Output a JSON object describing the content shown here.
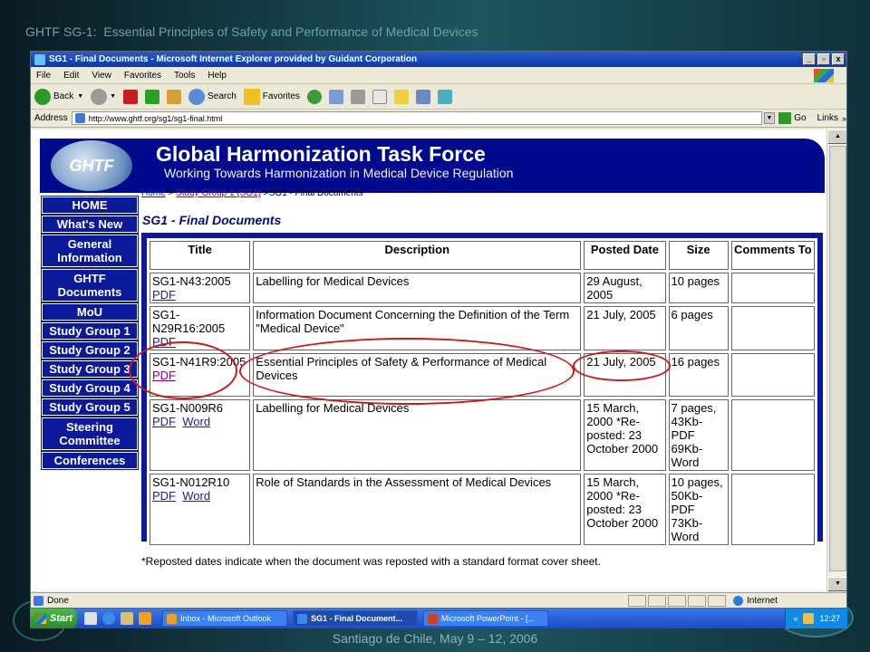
{
  "slide": {
    "title": "GHTF SG-1:  Essential Principles of Safety and Performance of Medical Devices",
    "footer": "Santiago de Chile, May 9 – 12, 2006"
  },
  "window": {
    "title": "SG1 - Final Documents - Microsoft Internet Explorer provided by Guidant Corporation",
    "minimize": "_",
    "maximize": "▫",
    "close": "x"
  },
  "menu": [
    "File",
    "Edit",
    "View",
    "Favorites",
    "Tools",
    "Help"
  ],
  "toolbar": {
    "back": "Back",
    "search": "Search",
    "favorites": "Favorites"
  },
  "address": {
    "label": "Address",
    "url": "http://www.ghtf.org/sg1/sg1-final.html",
    "go": "Go",
    "links": "Links"
  },
  "banner": {
    "logo": "GHTF",
    "title": "Global Harmonization Task Force",
    "subtitle": "Working Towards Harmonization in Medical Device Regulation"
  },
  "nav": [
    "HOME",
    "What's New",
    "General Information",
    "GHTF Documents",
    "MoU",
    "Study Group 1",
    "Study Group 2",
    "Study Group 3",
    "Study Group 4",
    "Study Group 5",
    "Steering Committee",
    "Conferences"
  ],
  "breadcrumb": {
    "home": "Home",
    "sep1": " > ",
    "group": "Study Group 1 (SG1)",
    "current": " >SG1 - Final Documents"
  },
  "page_title": "SG1 - Final Documents",
  "table": {
    "headers": [
      "Title",
      "Description",
      "Posted Date",
      "Size",
      "Comments To"
    ],
    "rows": [
      {
        "title": "SG1-N43:2005",
        "links": [
          "PDF"
        ],
        "description": "Labelling for Medical Devices",
        "date": "29 August, 2005",
        "size": "10 pages",
        "comments": ""
      },
      {
        "title": "SG1-N29R16:2005",
        "links": [
          "PDF"
        ],
        "description": "Information Document Concerning the Definition of the Term \"Medical Device\"",
        "date": "21 July, 2005",
        "size": "6 pages",
        "comments": ""
      },
      {
        "title": "SG1-N41R9:2005",
        "links": [
          "PDF"
        ],
        "description": "Essential Principles of Safety & Performance of Medical Devices",
        "date": "21 July, 2005",
        "size": "16 pages",
        "comments": ""
      },
      {
        "title": "SG1-N009R6",
        "links": [
          "PDF",
          "Word"
        ],
        "description": "Labelling for Medical Devices",
        "date": "15 March, 2000 *Re-posted: 23 October 2000",
        "size": "7 pages, 43Kb- PDF 69Kb- Word",
        "comments": ""
      },
      {
        "title": "SG1-N012R10",
        "links": [
          "PDF",
          "Word"
        ],
        "description": "Role of Standards in the Assessment of Medical Devices",
        "date": "15 March, 2000 *Re-posted: 23 October 2000",
        "size": "10 pages, 50Kb- PDF 73Kb- Word",
        "comments": ""
      }
    ]
  },
  "note": "*Reposted dates indicate when the document was reposted with a standard format cover sheet.",
  "status": {
    "text": "Done",
    "zone": "Internet"
  },
  "taskbar": {
    "start": "Start",
    "tasks": [
      "Inbox - Microsoft Outlook",
      "SG1 - Final Document...",
      "Microsoft PowerPoint - [..."
    ],
    "tray_arrow": "«",
    "clock": "12:27"
  },
  "colors": {
    "accent": "#000a8c",
    "annotation": "#d01818"
  }
}
